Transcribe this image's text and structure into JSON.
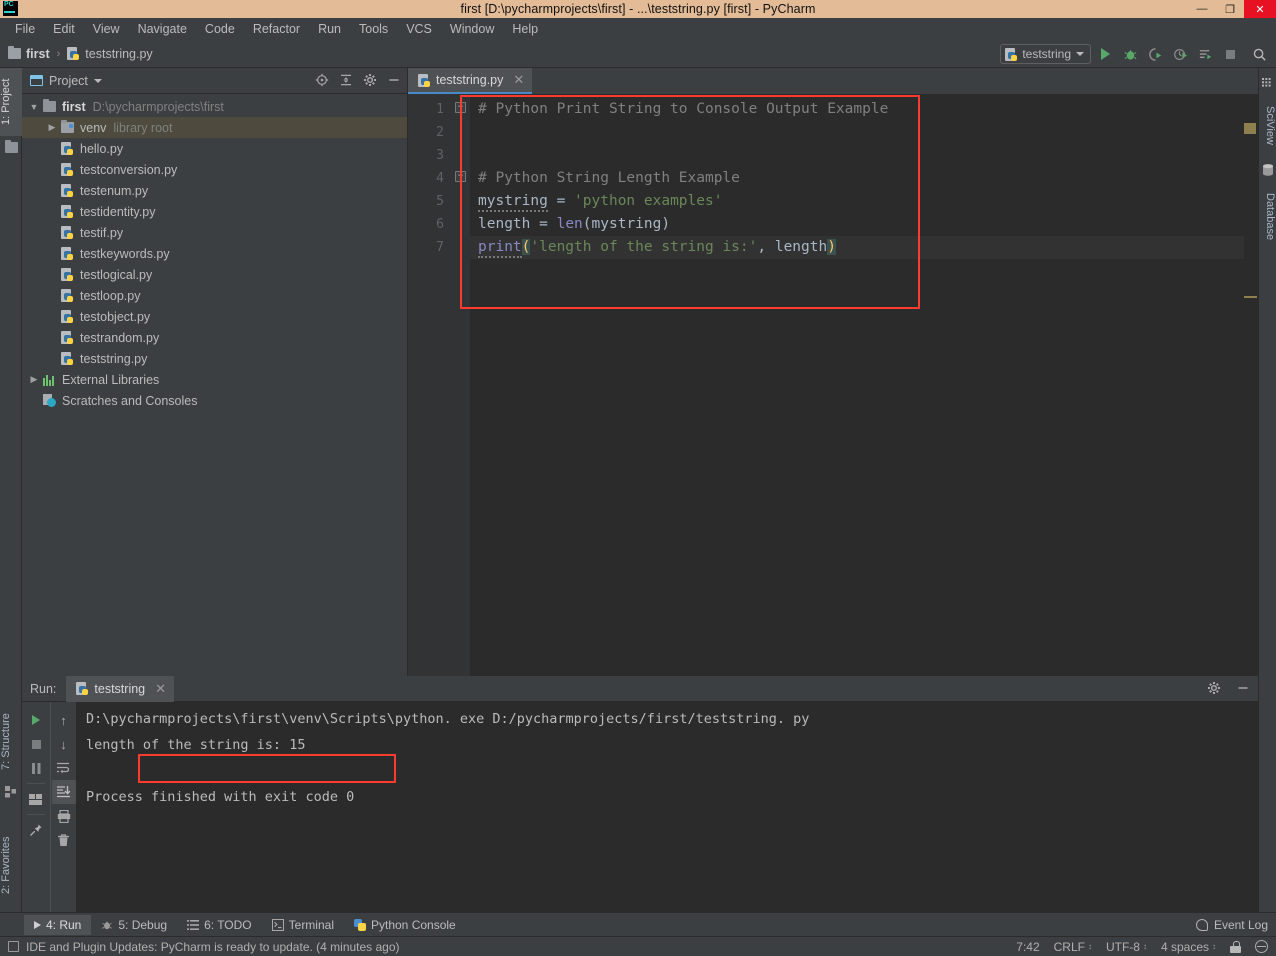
{
  "window": {
    "title": "first [D:\\pycharmprojects\\first] - ...\\teststring.py [first] - PyCharm",
    "logo": "pycharm-logo",
    "minimize": "—",
    "maximize": "❐",
    "close": "✕"
  },
  "menubar": {
    "items": [
      {
        "label": "File"
      },
      {
        "label": "Edit"
      },
      {
        "label": "View"
      },
      {
        "label": "Navigate"
      },
      {
        "label": "Code"
      },
      {
        "label": "Refactor"
      },
      {
        "label": "Run"
      },
      {
        "label": "Tools"
      },
      {
        "label": "VCS"
      },
      {
        "label": "Window"
      },
      {
        "label": "Help"
      }
    ]
  },
  "navbar": {
    "crumbs": [
      {
        "label": "first",
        "icon": "folder-icon"
      },
      {
        "label": "teststring.py",
        "icon": "python-file-icon"
      }
    ],
    "separator": "›",
    "run_config": "teststring",
    "buttons": [
      "run-icon",
      "debug-icon",
      "run-coverage-icon",
      "profile-icon",
      "run-with-console-icon",
      "stop-icon",
      "search-icon"
    ]
  },
  "left_strip": {
    "tabs": [
      {
        "label": "1: Project",
        "active": true
      },
      {
        "label": "7: Structure",
        "active": false
      },
      {
        "label": "2: Favorites",
        "active": false
      }
    ]
  },
  "right_strip": {
    "tabs": [
      {
        "label": "SciView"
      },
      {
        "label": "Database"
      }
    ]
  },
  "project_panel": {
    "title": "Project",
    "header_icons": [
      "locate-icon",
      "collapse-all-icon",
      "gear-icon",
      "hide-icon"
    ],
    "tree": [
      {
        "arrow": "▼",
        "label": "first",
        "sub": "D:\\pycharmprojects\\first",
        "icon": "folder-icon",
        "indent": 0,
        "bold": true,
        "selected": false
      },
      {
        "arrow": "▶",
        "label": "venv",
        "sub": "library root",
        "icon": "folder-venv-icon",
        "indent": 1,
        "bold": false,
        "selected": true
      },
      {
        "arrow": "",
        "label": "hello.py",
        "sub": "",
        "icon": "python-file-icon",
        "indent": 1,
        "bold": false,
        "selected": false
      },
      {
        "arrow": "",
        "label": "testconversion.py",
        "sub": "",
        "icon": "python-file-icon",
        "indent": 1,
        "bold": false,
        "selected": false
      },
      {
        "arrow": "",
        "label": "testenum.py",
        "sub": "",
        "icon": "python-file-icon",
        "indent": 1,
        "bold": false,
        "selected": false
      },
      {
        "arrow": "",
        "label": "testidentity.py",
        "sub": "",
        "icon": "python-file-icon",
        "indent": 1,
        "bold": false,
        "selected": false
      },
      {
        "arrow": "",
        "label": "testif.py",
        "sub": "",
        "icon": "python-file-icon",
        "indent": 1,
        "bold": false,
        "selected": false
      },
      {
        "arrow": "",
        "label": "testkeywords.py",
        "sub": "",
        "icon": "python-file-icon",
        "indent": 1,
        "bold": false,
        "selected": false
      },
      {
        "arrow": "",
        "label": "testlogical.py",
        "sub": "",
        "icon": "python-file-icon",
        "indent": 1,
        "bold": false,
        "selected": false
      },
      {
        "arrow": "",
        "label": "testloop.py",
        "sub": "",
        "icon": "python-file-icon",
        "indent": 1,
        "bold": false,
        "selected": false
      },
      {
        "arrow": "",
        "label": "testobject.py",
        "sub": "",
        "icon": "python-file-icon",
        "indent": 1,
        "bold": false,
        "selected": false
      },
      {
        "arrow": "",
        "label": "testrandom.py",
        "sub": "",
        "icon": "python-file-icon",
        "indent": 1,
        "bold": false,
        "selected": false
      },
      {
        "arrow": "",
        "label": "teststring.py",
        "sub": "",
        "icon": "python-file-icon",
        "indent": 1,
        "bold": false,
        "selected": false
      },
      {
        "arrow": "▶",
        "label": "External Libraries",
        "sub": "",
        "icon": "external-libraries-icon",
        "indent": 0,
        "bold": false,
        "selected": false
      },
      {
        "arrow": "",
        "label": "Scratches and Consoles",
        "sub": "",
        "icon": "scratches-icon",
        "indent": 0,
        "bold": false,
        "selected": false
      }
    ]
  },
  "editor": {
    "tab": {
      "label": "teststring.py",
      "close": "✕"
    },
    "line_numbers": [
      "1",
      "2",
      "3",
      "4",
      "5",
      "6",
      "7"
    ],
    "lines": [
      {
        "n": 1,
        "fold": "−",
        "current": false,
        "tokens": [
          {
            "t": "# Python Print String to Console Output Example",
            "c": "tok-comment"
          }
        ]
      },
      {
        "n": 2,
        "fold": "",
        "current": false,
        "tokens": []
      },
      {
        "n": 3,
        "fold": "",
        "current": false,
        "tokens": []
      },
      {
        "n": 4,
        "fold": "−",
        "current": false,
        "tokens": [
          {
            "t": "# Python String Length Example",
            "c": "tok-comment"
          }
        ]
      },
      {
        "n": 5,
        "fold": "",
        "current": false,
        "tokens": [
          {
            "t": "mystring",
            "c": "tok-var squig"
          },
          {
            "t": " = ",
            "c": "tok-op"
          },
          {
            "t": "'python examples'",
            "c": "tok-str"
          }
        ]
      },
      {
        "n": 6,
        "fold": "",
        "current": false,
        "tokens": [
          {
            "t": "length",
            "c": "tok-var"
          },
          {
            "t": " = ",
            "c": "tok-op"
          },
          {
            "t": "len",
            "c": "tok-builtin"
          },
          {
            "t": "(mystring)",
            "c": "tok-var"
          }
        ]
      },
      {
        "n": 7,
        "fold": "",
        "current": true,
        "tokens": [
          {
            "t": "print",
            "c": "tok-fn squig"
          },
          {
            "t": "(",
            "c": "tok-paren-hl"
          },
          {
            "t": "'length of the string is:'",
            "c": "tok-str"
          },
          {
            "t": ", ",
            "c": "tok-op"
          },
          {
            "t": "length",
            "c": "tok-var"
          },
          {
            "t": ")",
            "c": "tok-paren-hl"
          }
        ]
      }
    ],
    "highlight_box": "red-annotation-box"
  },
  "run_panel": {
    "label": "Run:",
    "tab": {
      "label": "teststring",
      "close": "✕"
    },
    "header_icons": [
      "gear-icon",
      "hide-icon"
    ],
    "left_toolbar": [
      "rerun-icon",
      "stop-icon",
      "pause-icon",
      "layout-icon",
      "pin-icon"
    ],
    "right_toolbar": [
      "up-arrow-icon",
      "down-arrow-icon",
      "soft-wrap-icon",
      "scroll-to-end-icon",
      "print-icon",
      "clear-all-icon"
    ],
    "console_lines": [
      "D:\\pycharmprojects\\first\\venv\\Scripts\\python. exe D:/pycharmprojects/first/teststring. py",
      "length of the string is: 15",
      "",
      "Process finished with exit code 0"
    ],
    "highlight_box": "red-annotation-box"
  },
  "bottom_strip": {
    "tabs": [
      {
        "label": "4: Run",
        "icon": "run-icon",
        "active": true
      },
      {
        "label": "5: Debug",
        "icon": "debug-icon",
        "active": false
      },
      {
        "label": "6: TODO",
        "icon": "todo-icon",
        "active": false
      },
      {
        "label": "Terminal",
        "icon": "terminal-icon",
        "active": false
      },
      {
        "label": "Python Console",
        "icon": "python-console-icon",
        "active": false
      }
    ],
    "event_log": "Event Log"
  },
  "statusbar": {
    "message": "IDE and Plugin Updates: PyCharm is ready to update. (4 minutes ago)",
    "message_icon": "note-icon",
    "caret_position": "7:42",
    "line_separator": "CRLF",
    "encoding": "UTF-8",
    "indent": "4 spaces",
    "lock": "lock-icon",
    "hierarchy": "hierarchy-icon",
    "caret_glyph": "↕"
  },
  "colors": {
    "title_bg": "#e3bc97",
    "chrome_bg": "#3c3f41",
    "editor_bg": "#2b2b2b",
    "accent_blue": "#4a88c7",
    "run_green": "#59a869",
    "annotation_red": "#ff3b30",
    "string_green": "#6A8759",
    "comment_gray": "#808080",
    "selection_olive": "#4e4a3e"
  }
}
